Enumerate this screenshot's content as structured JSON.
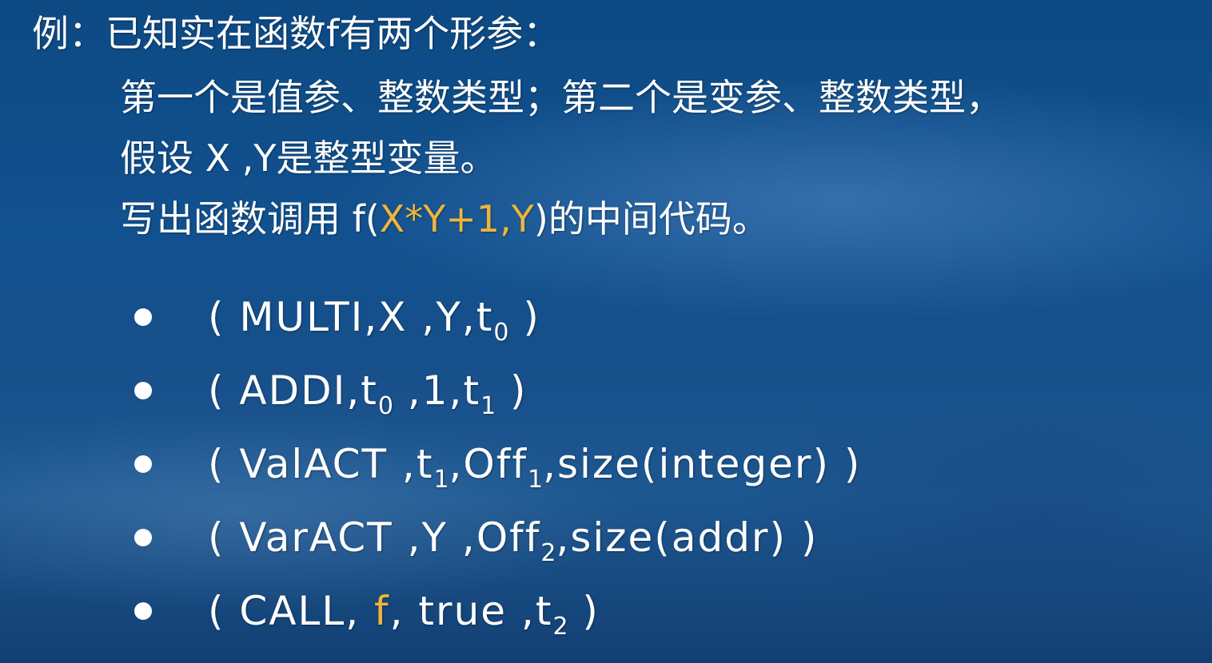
{
  "colors": {
    "highlight": "#f0b43c",
    "text": "#ffffff"
  },
  "intro": {
    "line1": "例：已知实在函数f有两个形参：",
    "line2": "第一个是值参、整数类型；第二个是变参、整数类型，",
    "line3": "假设 X ,Y是整型变量。",
    "line4_prefix": "写出函数调用 f(",
    "line4_highlight": "X*Y+1,Y",
    "line4_suffix": ")的中间代码。"
  },
  "code": {
    "item1": {
      "a": "( MULTI,X ,Y,t",
      "s1": "0",
      "b": " )"
    },
    "item2": {
      "a": "( ADDI,t",
      "s1": "0",
      "b": " ,1,t",
      "s2": "1",
      "c": " )"
    },
    "item3": {
      "a": "( ValACT ,t",
      "s1": "1",
      "b": ",Off",
      "s2": "1",
      "c": ",size(integer) )"
    },
    "item4": {
      "a": "( VarACT ,Y ,Off",
      "s1": "2",
      "b": ",size(addr) )"
    },
    "item5": {
      "a": "( CALL, ",
      "hl": "f",
      "b": ", true ,t",
      "s1": "2",
      "c": " )"
    }
  }
}
